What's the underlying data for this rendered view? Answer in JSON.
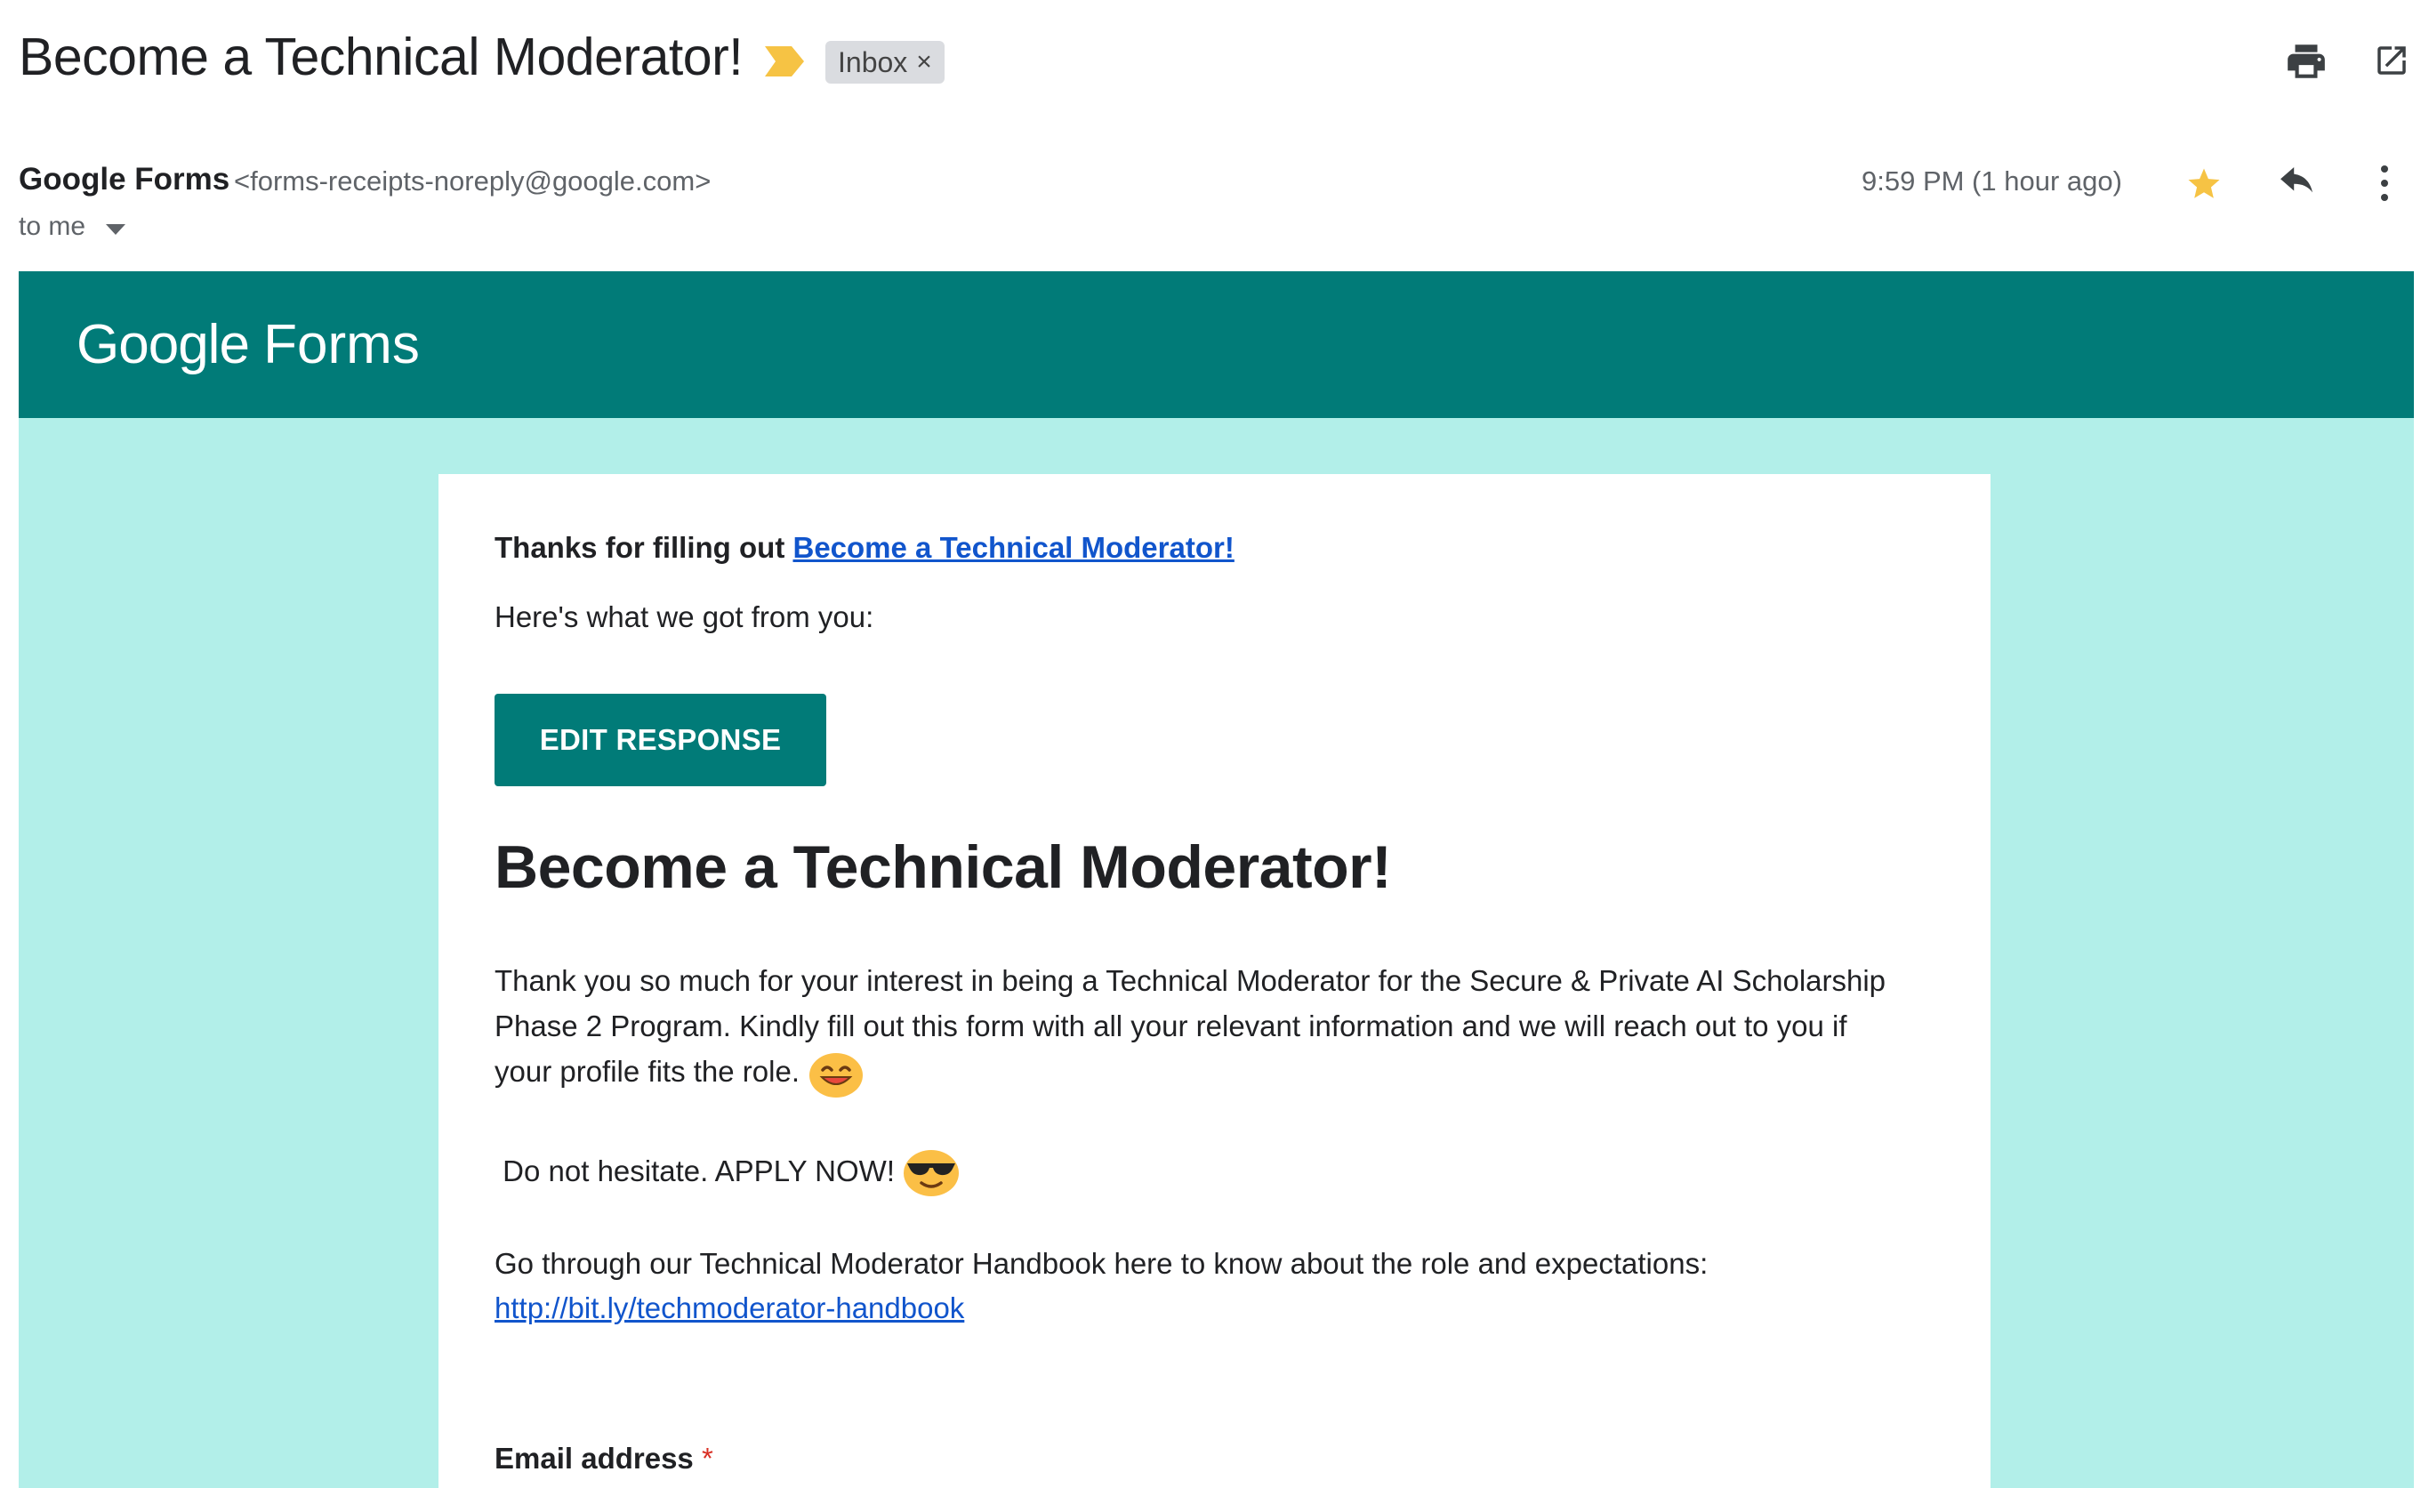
{
  "header": {
    "subject": "Become a Technical Moderator!",
    "label": "Inbox",
    "label_remove": "×",
    "icons": [
      "importance-marker-icon",
      "print-icon",
      "open-in-new-window-icon"
    ]
  },
  "sender": {
    "name": "Google Forms",
    "email": "<forms-receipts-noreply@google.com>",
    "recipient": "to me",
    "timestamp": "9:59 PM (1 hour ago)",
    "icons": [
      "star-icon",
      "reply-icon",
      "more-vertical-icon"
    ]
  },
  "colors": {
    "banner": "#017b78",
    "body_bg": "#b2efe9",
    "link": "#1155cc",
    "star": "#f6c344",
    "required": "#d93025"
  },
  "email_body": {
    "logo_google": "Google",
    "logo_forms": "Forms",
    "thanks_prefix": "Thanks for filling out ",
    "thanks_link": "Become a Technical Moderator!",
    "intro": "Here's what we got from you:",
    "edit_button": "EDIT RESPONSE",
    "form_title": "Become a Technical Moderator!",
    "description_line1": "Thank you so much for your interest in being a Technical Moderator for the Secure & Private AI Scholarship",
    "description_line2": "Phase 2 Program. Kindly fill out this form with all your relevant information and we will reach out to you if",
    "description_line3": "your profile fits the role.",
    "apply_text": " Do not hesitate. APPLY NOW!",
    "handbook_text": "Go through our Technical Moderator Handbook here to know about the role and expectations:",
    "handbook_link": "http://bit.ly/techmoderator-handbook",
    "field_label": "Email address",
    "required_marker": "*"
  }
}
